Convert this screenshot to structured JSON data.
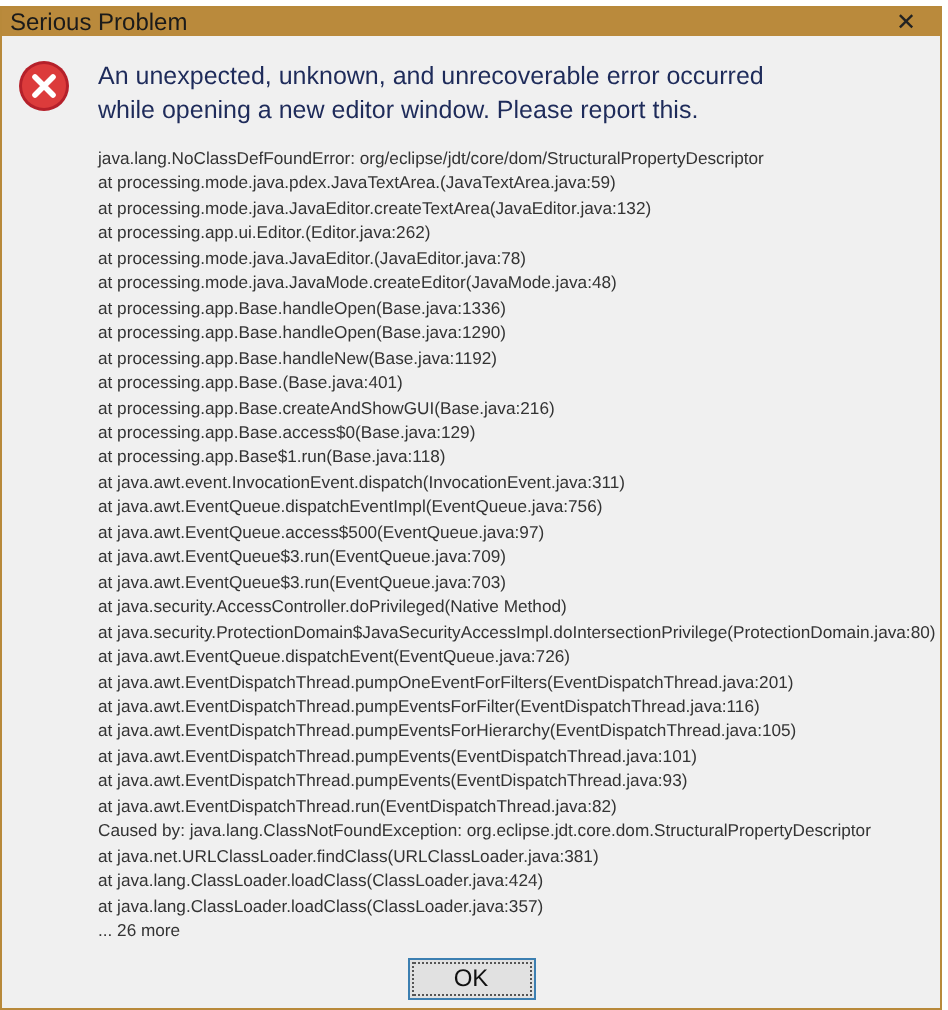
{
  "window": {
    "title": "Serious Problem",
    "close": "✕"
  },
  "message": [
    "An unexpected, unknown, and unrecoverable error occurred",
    "while opening a new editor window. Please report this."
  ],
  "details": [
    "java.lang.NoClassDefFoundError: org/eclipse/jdt/core/dom/StructuralPropertyDescriptor",
    "at processing.mode.java.pdex.JavaTextArea.(JavaTextArea.java:59)",
    "at processing.mode.java.JavaEditor.createTextArea(JavaEditor.java:132)",
    "at processing.app.ui.Editor.(Editor.java:262)",
    "at processing.mode.java.JavaEditor.(JavaEditor.java:78)",
    "at processing.mode.java.JavaMode.createEditor(JavaMode.java:48)",
    "at processing.app.Base.handleOpen(Base.java:1336)",
    "at processing.app.Base.handleOpen(Base.java:1290)",
    "at processing.app.Base.handleNew(Base.java:1192)",
    "at processing.app.Base.(Base.java:401)",
    "at processing.app.Base.createAndShowGUI(Base.java:216)",
    "at processing.app.Base.access$0(Base.java:129)",
    "at processing.app.Base$1.run(Base.java:118)",
    "at java.awt.event.InvocationEvent.dispatch(InvocationEvent.java:311)",
    "at java.awt.EventQueue.dispatchEventImpl(EventQueue.java:756)",
    "at java.awt.EventQueue.access$500(EventQueue.java:97)",
    "at java.awt.EventQueue$3.run(EventQueue.java:709)",
    "at java.awt.EventQueue$3.run(EventQueue.java:703)",
    "at java.security.AccessController.doPrivileged(Native Method)",
    "at java.security.ProtectionDomain$JavaSecurityAccessImpl.doIntersectionPrivilege(ProtectionDomain.java:80)",
    "at java.awt.EventQueue.dispatchEvent(EventQueue.java:726)",
    "at java.awt.EventDispatchThread.pumpOneEventForFilters(EventDispatchThread.java:201)",
    "at java.awt.EventDispatchThread.pumpEventsForFilter(EventDispatchThread.java:116)",
    "at java.awt.EventDispatchThread.pumpEventsForHierarchy(EventDispatchThread.java:105)",
    "at java.awt.EventDispatchThread.pumpEvents(EventDispatchThread.java:101)",
    "at java.awt.EventDispatchThread.pumpEvents(EventDispatchThread.java:93)",
    "at java.awt.EventDispatchThread.run(EventDispatchThread.java:82)",
    "Caused by: java.lang.ClassNotFoundException: org.eclipse.jdt.core.dom.StructuralPropertyDescriptor",
    "at java.net.URLClassLoader.findClass(URLClassLoader.java:381)",
    "at java.lang.ClassLoader.loadClass(ClassLoader.java:424)",
    "at java.lang.ClassLoader.loadClass(ClassLoader.java:357)",
    "... 26 more"
  ],
  "buttons": [
    "OK"
  ]
}
